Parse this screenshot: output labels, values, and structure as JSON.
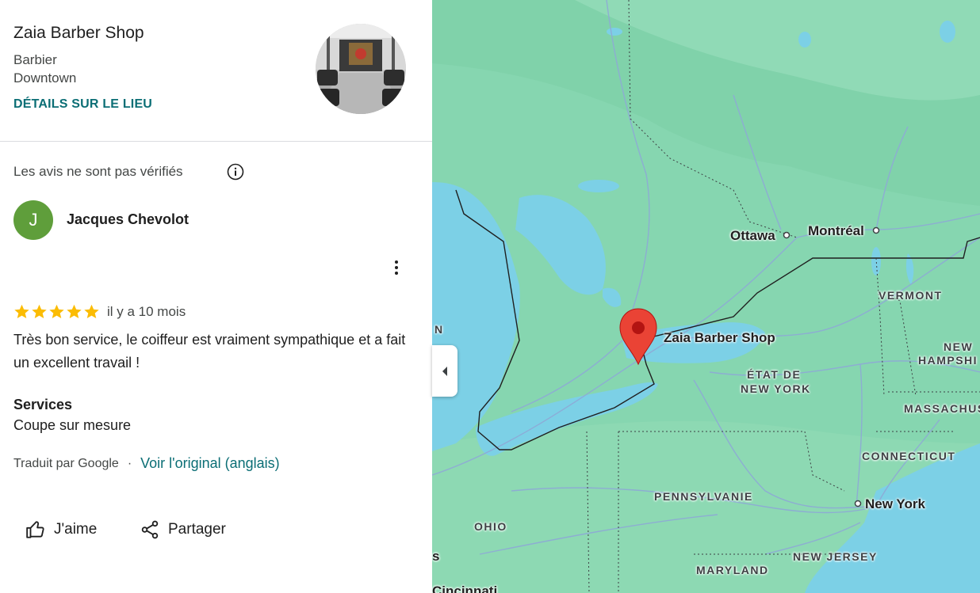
{
  "place": {
    "name": "Zaia Barber Shop",
    "category": "Barbier",
    "area": "Downtown",
    "details_link": "DÉTAILS SUR LE LIEU"
  },
  "review": {
    "notice": "Les avis ne sont pas vérifiés",
    "author_initial": "J",
    "author": "Jacques Chevolot",
    "rating": 5,
    "date": "il y a 10 mois",
    "text": "Très bon service, le coiffeur est vraiment sympathique et a fait un excellent travail !",
    "services_title": "Services",
    "services_value": "Coupe sur mesure",
    "translated_by": "Traduit par Google",
    "dot": "·",
    "see_original": "Voir l'original (anglais)"
  },
  "actions": {
    "like": "J'aime",
    "share": "Partager"
  },
  "map": {
    "labels": {
      "ottawa": "Ottawa",
      "montreal": "Montréal",
      "vermont": "VERMONT",
      "new_hampshire_1": "NEW",
      "new_hampshire_2": "HAMPSHI",
      "pin_label": "Zaia Barber Shop",
      "ny_state_1": "ÉTAT DE",
      "ny_state_2": "NEW YORK",
      "massachusetts": "MASSACHUS",
      "connecticut": "CONNECTICUT",
      "pennsylvania": "PENNSYLVANIE",
      "new_york": "New York",
      "ohio": "OHIO",
      "maryland": "MARYLAND",
      "new_jersey": "NEW JERSEY",
      "cincinnati": "Cincinnati",
      "cut_n": "N",
      "cut_s": "s"
    }
  },
  "colors": {
    "accent": "#0b6e75",
    "avatar": "#5f9e3b",
    "star": "#fbbc04",
    "land": "#86d6b0",
    "water": "#7cd0e6",
    "pin": "#ea4335"
  }
}
